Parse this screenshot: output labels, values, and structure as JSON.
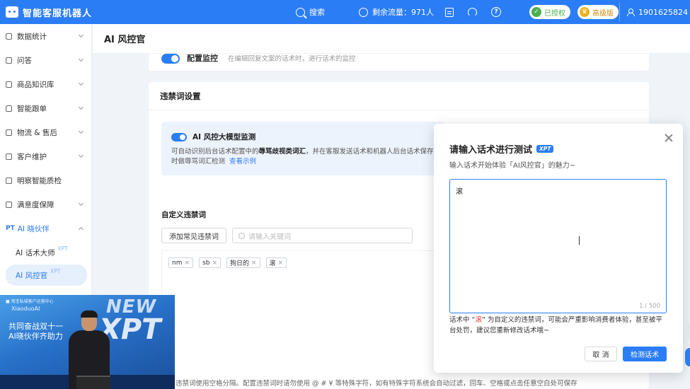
{
  "topbar": {
    "app_title": "智能客服机器人",
    "search_label": "搜索",
    "traffic_label": "剩余流量：971人",
    "auth_badge": "已授权",
    "auth_icon": "shield-check-icon",
    "plan_badge": "高级版",
    "plan_icon": "crown-icon",
    "username": "1901625824",
    "brand_color": "#2b7df5"
  },
  "sidebar": {
    "items": [
      {
        "label": "数据统计"
      },
      {
        "label": "问答"
      },
      {
        "label": "商品知识库"
      },
      {
        "label": "智能跟单"
      },
      {
        "label": "物流 & 售后"
      },
      {
        "label": "客户维护"
      },
      {
        "label": "明察智能质检"
      },
      {
        "label": "满意度保障"
      }
    ],
    "group": {
      "prefix": "PT",
      "label": "AI 晓伙伴"
    },
    "sub_items": [
      {
        "label": "AI 话术大师",
        "badge": "XPT"
      },
      {
        "label": "AI 风控官",
        "badge": "XPT"
      }
    ]
  },
  "page": {
    "title": "AI 风控官"
  },
  "config_card": {
    "label": "配置监控",
    "desc": "在编辑回复文案的话术时，进行话术的监控"
  },
  "banned_card": {
    "title": "违禁词设置",
    "ai_title": "AI 风控大模型监测",
    "ai_desc_1": "可自动识别后台话术配置中的",
    "ai_desc_bold": "辱骂歧视类词汇",
    "ai_desc_2": "，并在客服发送话术和机器人后台话术保存时做辱骂词汇检测",
    "ai_link": "查看示例",
    "custom_label": "自定义违禁词",
    "add_button": "添加常见违禁词",
    "search_placeholder": "请输入关键词",
    "tags": [
      "nm",
      "sb",
      "狗日的",
      "滚"
    ],
    "hint": "违禁词使用空格分隔。配置违禁词时请勿使用 @ # ¥ 等特殊字符，如有特殊字符系统会自动过滤，回车、空格或点击任意空白处可保存"
  },
  "dialog": {
    "title": "请输入话术进行测试",
    "badge": "XPT",
    "subtitle": "输入话术开始体验「AI风控官」的魅力~",
    "input_value": "滚",
    "counter": "1 / 500",
    "warn_prefix": "话术中 “",
    "warn_keyword": "滚",
    "warn_suffix": "” 为自定义的违禁词，可能会严重影响消费者体验，甚至被平台处罚，建议您重新修改话术哦~",
    "cancel": "取 消",
    "submit": "检测话术"
  },
  "video": {
    "small": "■ 淘宝私域客户运营中心",
    "brand": "XiaoduoAI",
    "line1": "共同奋战双十一",
    "line2": "AI晓伙伴齐助力",
    "new_text": "NEW",
    "xpt_text": "XPT"
  }
}
